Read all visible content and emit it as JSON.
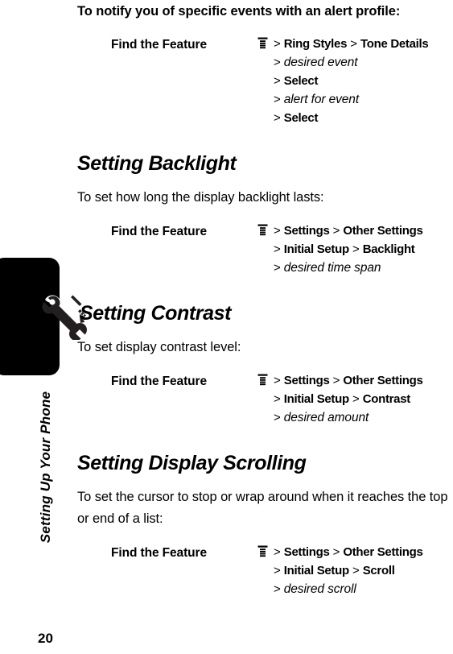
{
  "page": {
    "number": "20",
    "chapter_label": "Setting Up Your Phone",
    "tab_icon": "wrench-screwdriver-icon"
  },
  "intro": {
    "text": "To notify you of specific events with an alert profile:"
  },
  "feature_label": "Find the Feature",
  "icons": {
    "menu": "menu-key-icon"
  },
  "sections": [
    {
      "id": "alert-profile",
      "heading": null,
      "body": null,
      "path_lines": [
        [
          {
            "t": ">",
            "k": "gt"
          },
          {
            "t": "Ring Styles",
            "k": "menu-item"
          },
          {
            "t": ">",
            "k": "gt"
          },
          {
            "t": "Tone Details",
            "k": "menu-item"
          }
        ],
        [
          {
            "t": ">",
            "k": "gt"
          },
          {
            "t": "desired event",
            "k": "placeholder"
          }
        ],
        [
          {
            "t": ">",
            "k": "gt"
          },
          {
            "t": "Select",
            "k": "menu-item"
          }
        ],
        [
          {
            "t": ">",
            "k": "gt"
          },
          {
            "t": "alert for event",
            "k": "placeholder"
          }
        ],
        [
          {
            "t": ">",
            "k": "gt"
          },
          {
            "t": "Select",
            "k": "menu-item"
          }
        ]
      ]
    },
    {
      "id": "backlight",
      "heading": "Setting Backlight",
      "body": "To set how long the display backlight lasts:",
      "path_lines": [
        [
          {
            "t": ">",
            "k": "gt"
          },
          {
            "t": "Settings",
            "k": "menu-item"
          },
          {
            "t": ">",
            "k": "gt"
          },
          {
            "t": "Other Settings",
            "k": "menu-item"
          }
        ],
        [
          {
            "t": ">",
            "k": "gt"
          },
          {
            "t": "Initial Setup",
            "k": "menu-item"
          },
          {
            "t": ">",
            "k": "gt"
          },
          {
            "t": "Backlight",
            "k": "menu-item"
          }
        ],
        [
          {
            "t": ">",
            "k": "gt"
          },
          {
            "t": "desired time span",
            "k": "placeholder"
          }
        ]
      ]
    },
    {
      "id": "contrast",
      "heading": "Setting Contrast",
      "body": "To set display contrast level:",
      "path_lines": [
        [
          {
            "t": ">",
            "k": "gt"
          },
          {
            "t": "Settings",
            "k": "menu-item"
          },
          {
            "t": ">",
            "k": "gt"
          },
          {
            "t": "Other Settings",
            "k": "menu-item"
          }
        ],
        [
          {
            "t": ">",
            "k": "gt"
          },
          {
            "t": "Initial Setup",
            "k": "menu-item"
          },
          {
            "t": ">",
            "k": "gt"
          },
          {
            "t": "Contrast",
            "k": "menu-item"
          }
        ],
        [
          {
            "t": ">",
            "k": "gt"
          },
          {
            "t": "desired amount",
            "k": "placeholder"
          }
        ]
      ]
    },
    {
      "id": "display-scrolling",
      "heading": "Setting Display Scrolling",
      "body": "To set the cursor to stop or wrap around when it reaches the top or end of a list:",
      "path_lines": [
        [
          {
            "t": ">",
            "k": "gt"
          },
          {
            "t": "Settings",
            "k": "menu-item"
          },
          {
            "t": ">",
            "k": "gt"
          },
          {
            "t": "Other Settings",
            "k": "menu-item"
          }
        ],
        [
          {
            "t": ">",
            "k": "gt"
          },
          {
            "t": "Initial Setup",
            "k": "menu-item"
          },
          {
            "t": ">",
            "k": "gt"
          },
          {
            "t": "Scroll",
            "k": "menu-item"
          }
        ],
        [
          {
            "t": ">",
            "k": "gt"
          },
          {
            "t": "desired scroll",
            "k": "placeholder"
          }
        ]
      ]
    }
  ],
  "colors": {
    "ink": "#000000",
    "paper": "#ffffff",
    "tab": "#000000"
  }
}
